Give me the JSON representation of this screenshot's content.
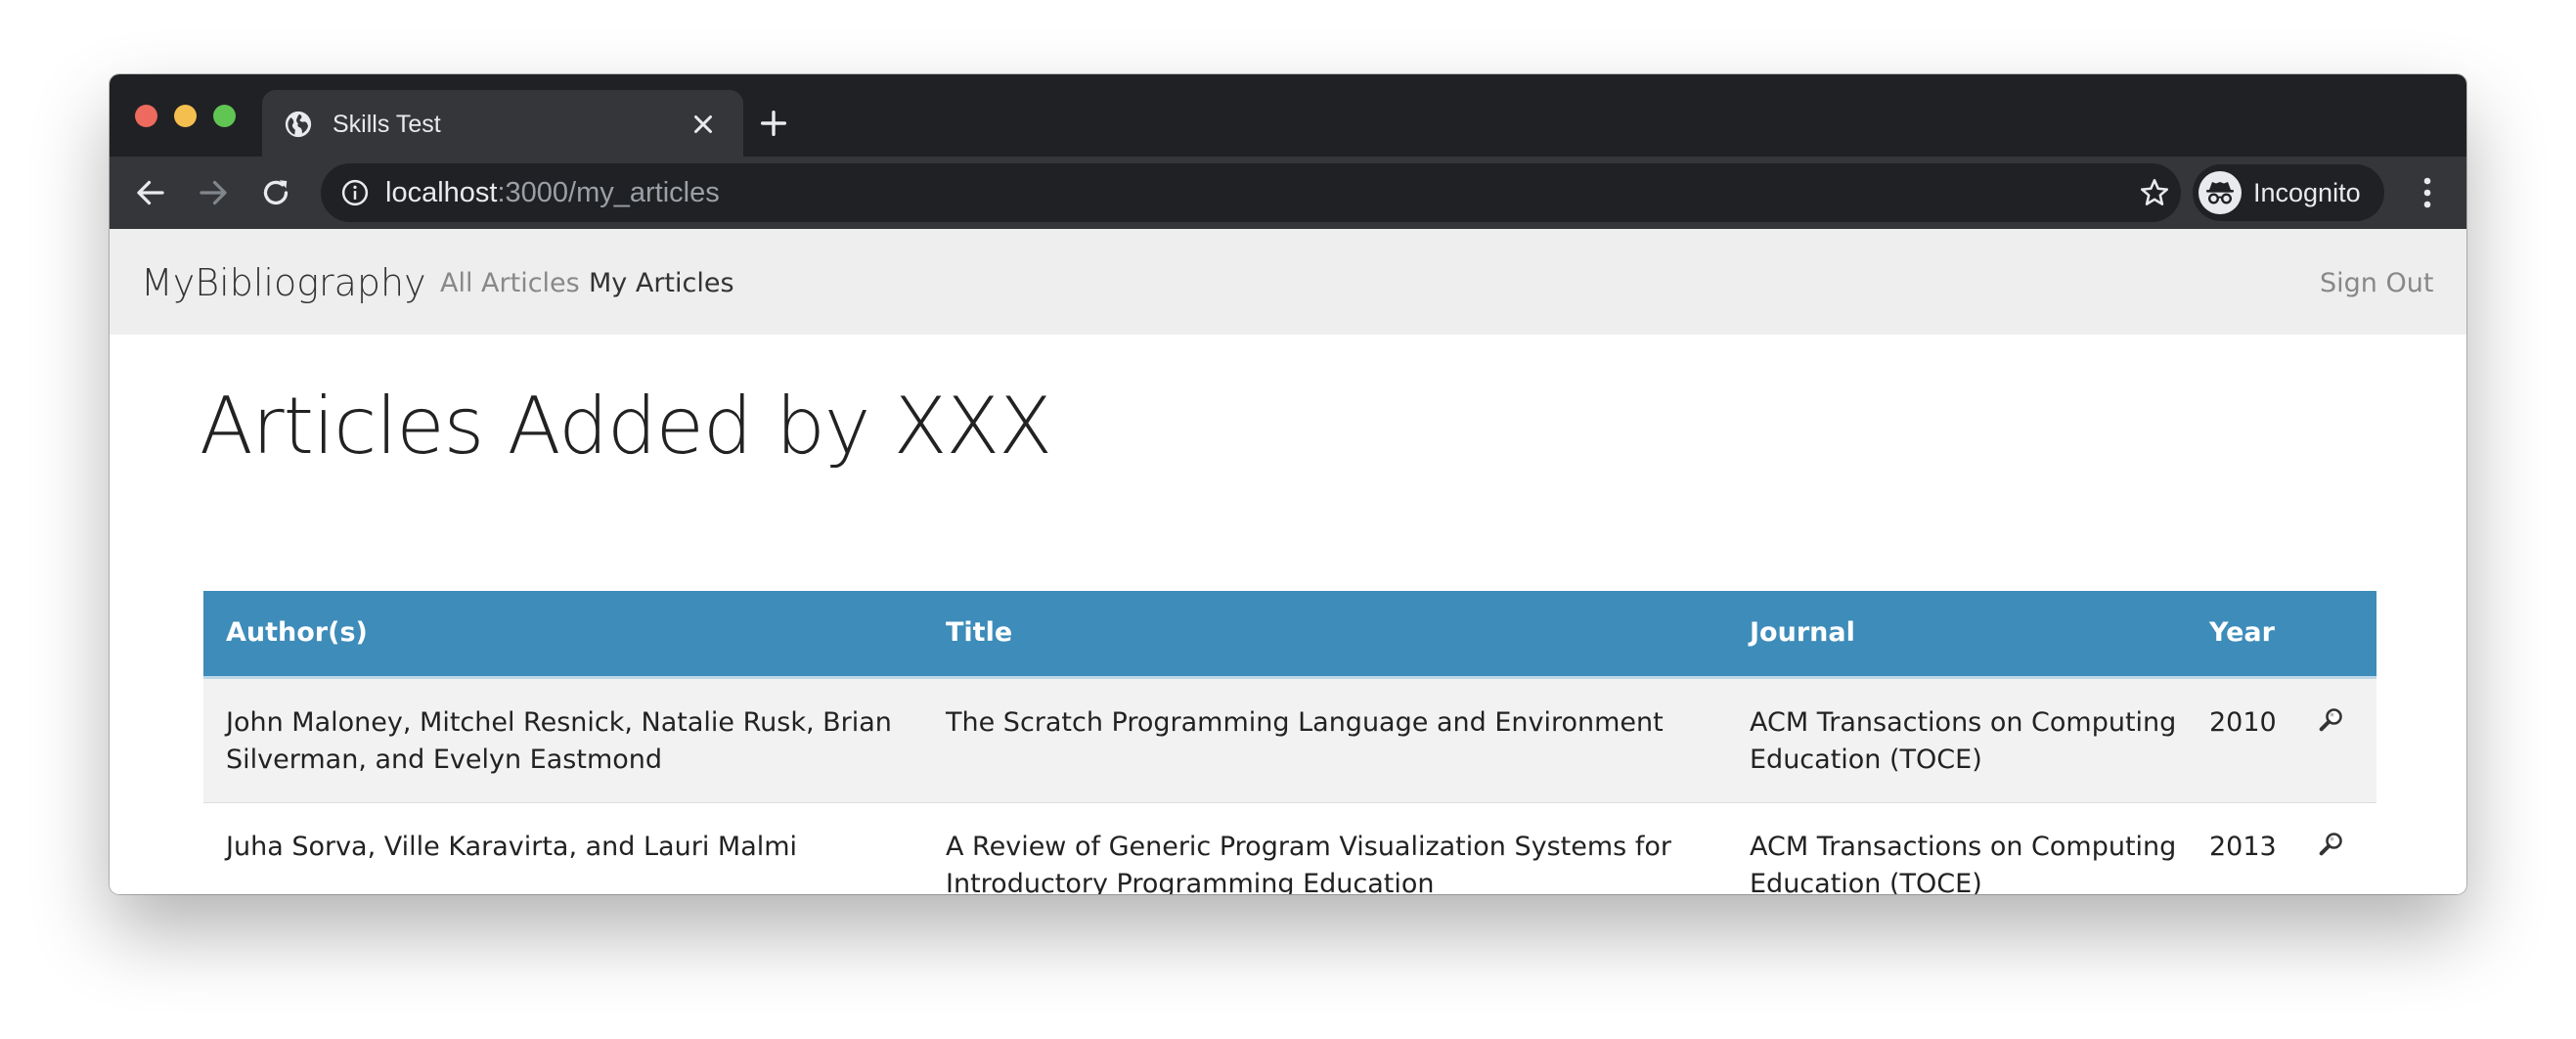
{
  "browser": {
    "tab_title": "Skills Test",
    "url_host": "localhost",
    "url_path": ":3000/my_articles",
    "profile_label": "Incognito",
    "icons": {
      "tab_favicon": "globe-icon",
      "tab_close": "close-icon",
      "new_tab": "plus-icon",
      "back": "arrow-left-icon",
      "forward": "arrow-right-icon",
      "reload": "reload-icon",
      "site_info": "info-icon",
      "bookmark": "star-icon",
      "profile": "incognito-icon",
      "menu": "kebab-menu-icon"
    },
    "colors": {
      "close": "#ed6a5e",
      "minimize": "#f5bf4f",
      "zoom": "#61c554"
    }
  },
  "navbar": {
    "brand": "MyBibliography",
    "links": [
      {
        "label": "All Articles",
        "active": false
      },
      {
        "label": "My Articles",
        "active": true
      }
    ],
    "sign_out": "Sign Out"
  },
  "main": {
    "heading": "Articles Added by XXX",
    "table": {
      "headers": [
        "Author(s)",
        "Title",
        "Journal",
        "Year"
      ],
      "rows": [
        {
          "authors": "John Maloney, Mitchel Resnick, Natalie Rusk, Brian Silverman, and Evelyn Eastmond",
          "title": "The Scratch Programming Language and Environment",
          "journal": "ACM Transactions on Computing Education (TOCE)",
          "year": "2010",
          "action_icon": "magnifier-icon"
        },
        {
          "authors": "Juha Sorva, Ville Karavirta, and Lauri Malmi",
          "title": "A Review of Generic Program Visualization Systems for Introductory Programming Education",
          "journal": "ACM Transactions on Computing Education (TOCE)",
          "year": "2013",
          "action_icon": "magnifier-icon"
        }
      ]
    },
    "colors": {
      "table_header": "#3d8cba",
      "navbar": "#eeeeee"
    }
  }
}
